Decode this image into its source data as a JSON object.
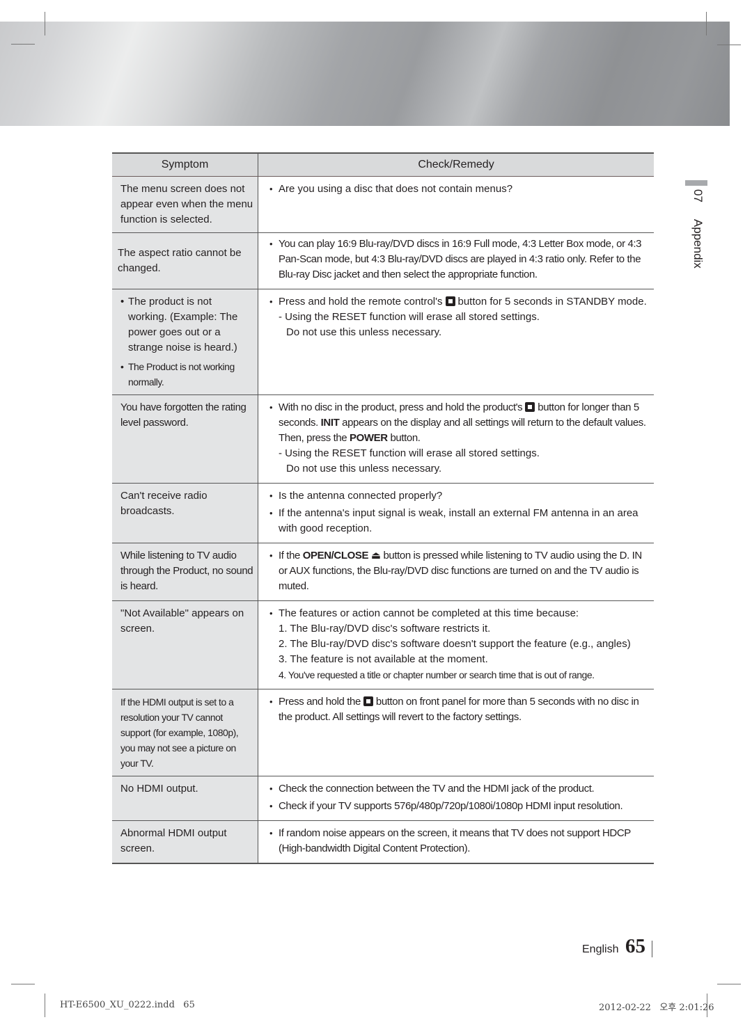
{
  "header": {
    "banner": "decorative-metallic-banner"
  },
  "table": {
    "columns": {
      "symptom": "Symptom",
      "remedy": "Check/Remedy"
    },
    "rows": [
      {
        "symptom": "The menu screen does not appear even when the menu function is selected.",
        "remedy": [
          "Are you using a disc that does not contain menus?"
        ]
      },
      {
        "symptom": "The aspect ratio cannot be changed.",
        "remedy": [
          "You can play 16:9 Blu-ray/DVD discs in 16:9 Full mode, 4:3 Letter Box mode, or 4:3 Pan-Scan mode, but 4:3 Blu-ray/DVD discs are played in 4:3 ratio only. Refer to the Blu-ray Disc jacket and then select the appropriate function."
        ]
      },
      {
        "symptom_bullets": [
          "The product is not working. (Example: The power goes out or a strange noise is heard.)",
          "The Product is not working normally."
        ],
        "remedy_pre": "Press and hold the remote control's",
        "remedy_icon": "stop-button-icon",
        "remedy_post": "button for 5 seconds in STANDBY mode.",
        "note_1": "- Using the RESET function will erase all stored settings.",
        "note_2": "Do not use this unless necessary."
      },
      {
        "symptom": "You have forgotten the rating level password.",
        "remedy_pre": "With no disc in the product, press and hold the product's",
        "remedy_icon": "stop-button-icon",
        "remedy_post": "button for longer than 5 seconds.",
        "init_label": "INIT",
        "remedy_mid": "appears on the display and all settings will return to the default values. Then, press the",
        "power_label": "POWER",
        "remedy_end": "button.",
        "note_1": "- Using the RESET function will erase all stored settings.",
        "note_2": "Do not use this unless necessary."
      },
      {
        "symptom": "Can't receive radio broadcasts.",
        "remedy": [
          "Is the antenna connected properly?",
          "If the antenna's input signal is weak, install an external FM antenna in an area with good reception."
        ]
      },
      {
        "symptom": "While listening to TV audio through the Product, no sound is heard.",
        "remedy_pre": "If the",
        "open_close_label": "OPEN/CLOSE",
        "eject_glyph": "⏏",
        "remedy_post": "button is pressed while listening to TV audio using the D. IN or AUX functions, the Blu-ray/DVD disc functions are turned on and the TV audio is muted."
      },
      {
        "symptom": "\"Not Available\" appears on screen.",
        "remedy_intro": "The features or action cannot be completed at this time because:",
        "reasons": [
          "1. The Blu-ray/DVD disc's software restricts it.",
          "2. The Blu-ray/DVD disc's software doesn't support the feature (e.g., angles)",
          "3. The feature is not available at the moment.",
          "4. You've requested a title or chapter number or search time that is out of range."
        ]
      },
      {
        "symptom": "If the HDMI output is set to a resolution your TV cannot support (for example, 1080p), you may not see a picture on your TV.",
        "remedy_pre": "Press and hold the",
        "remedy_icon": "stop-button-icon",
        "remedy_post": "button on front panel for more than 5 seconds with no disc in the product. All settings will revert to the factory settings."
      },
      {
        "symptom": "No HDMI output.",
        "remedy": [
          "Check the connection between the TV and the HDMI jack of the product.",
          "Check if your TV supports 576p/480p/720p/1080i/1080p HDMI input resolution."
        ]
      },
      {
        "symptom": "Abnormal HDMI output screen.",
        "remedy": [
          "If random noise appears on the screen, it means that TV does not support HDCP (High-bandwidth Digital Content Protection)."
        ]
      }
    ]
  },
  "side_tab": {
    "chapter": "07",
    "title": "Appendix"
  },
  "footer": {
    "language": "English",
    "page_number": "65",
    "slug_file": "HT-E6500_XU_0222.indd   65",
    "slug_date": "2012-02-22   오후 2:01:26"
  }
}
